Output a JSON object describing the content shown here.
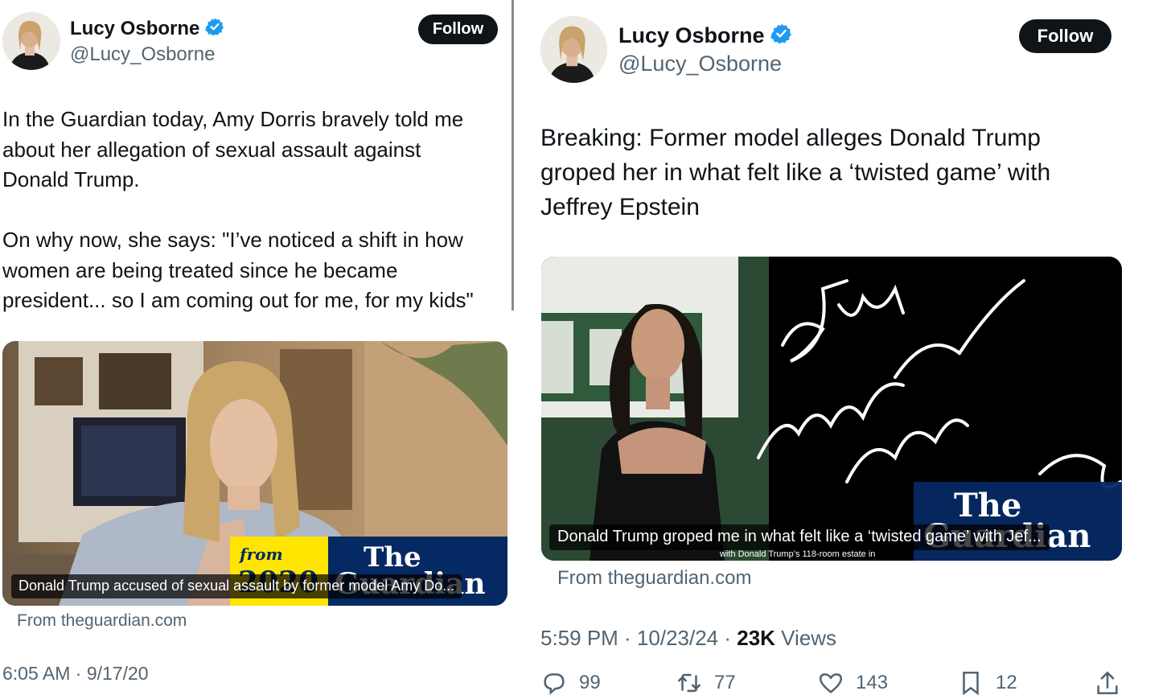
{
  "left_tweet": {
    "display_name": "Lucy Osborne",
    "handle": "@Lucy_Osborne",
    "follow_label": "Follow",
    "text_lines": [
      "In the Guardian today, Amy Dorris bravely told me",
      "about her allegation of sexual assault against",
      "Donald Trump.",
      "",
      "On why now, she says: \"I’ve noticed a shift in how",
      "women are being treated since he became",
      "president... so I am coming out for me, for my kids\""
    ],
    "card": {
      "caption": "Donald Trump accused of sexual assault by former model Amy Do...",
      "badge_from": "from",
      "badge_year": "2020",
      "brand_line1": "The",
      "brand_line2": "Guardian"
    },
    "source": "From theguardian.com",
    "timestamp": "6:05 AM · 9/17/20"
  },
  "right_tweet": {
    "display_name": "Lucy Osborne",
    "handle": "@Lucy_Osborne",
    "follow_label": "Follow",
    "text_lines": [
      "Breaking: Former model alleges Donald Trump",
      "groped her in what felt like a ‘twisted game’ with",
      "Jeffrey Epstein"
    ],
    "card": {
      "caption": "Donald Trump groped me in what felt like a ‘twisted game’ with Jef...",
      "photo_caption": "with Donald Trump’s 118-room estate in",
      "brand_line1": "The",
      "brand_line2": "Guardian"
    },
    "source": "From theguardian.com",
    "time_date": "5:59 PM · 10/23/24 · ",
    "views_count": "23K",
    "views_label": " Views",
    "actions": {
      "replies": "99",
      "reposts": "77",
      "likes": "143",
      "bookmarks": "12"
    }
  },
  "colors": {
    "verified": "#1d9bf0",
    "follow_bg": "#0f1419",
    "secondary_text": "#536471",
    "guardian_blue": "#052962",
    "badge_yellow": "#ffe500"
  }
}
